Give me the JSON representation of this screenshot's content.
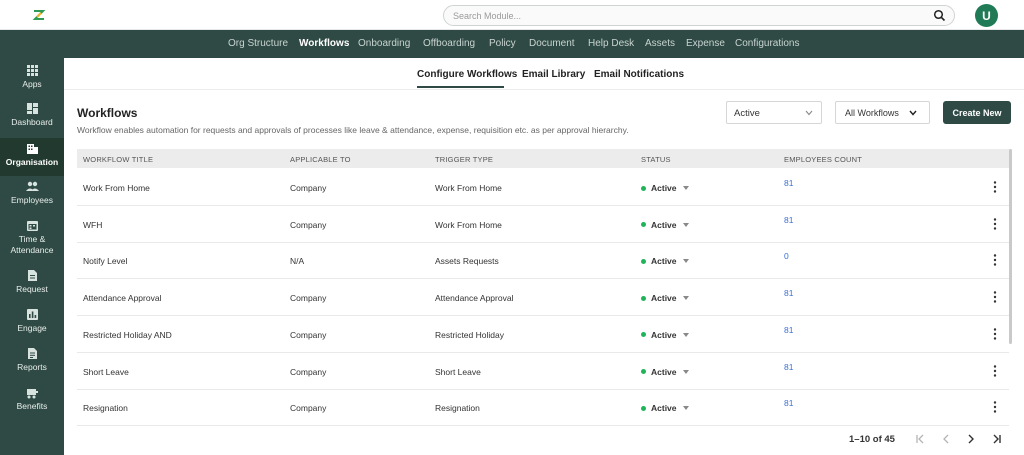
{
  "header": {
    "search_placeholder": "Search Module...",
    "avatar_initial": "U"
  },
  "topnav": {
    "items": [
      "Org Structure",
      "Workflows",
      "Onboarding",
      "Offboarding",
      "Policy",
      "Document",
      "Help Desk",
      "Assets",
      "Expense",
      "Configurations"
    ],
    "active": "Workflows"
  },
  "sidebar": {
    "items": [
      {
        "label": "Apps",
        "icon": "grid-icon"
      },
      {
        "label": "Dashboard",
        "icon": "dashboard-icon"
      },
      {
        "label": "Organisation",
        "icon": "building-icon"
      },
      {
        "label": "Employees",
        "icon": "people-icon"
      },
      {
        "label": "Time & Attendance",
        "icon": "calendar-icon"
      },
      {
        "label": "Request",
        "icon": "request-icon"
      },
      {
        "label": "Engage",
        "icon": "chart-icon"
      },
      {
        "label": "Reports",
        "icon": "report-icon"
      },
      {
        "label": "Benefits",
        "icon": "benefits-icon"
      }
    ],
    "active": "Organisation"
  },
  "subtabs": {
    "items": [
      "Configure Workflows",
      "Email Library",
      "Email Notifications"
    ],
    "active": "Configure Workflows"
  },
  "page": {
    "title": "Workflows",
    "description": "Workflow enables automation for requests and approvals of processes like leave & attendance, expense, requisition etc. as per approval hierarchy.",
    "status_filter": "Active",
    "workflow_filter": "All Workflows",
    "create_button": "Create New"
  },
  "table": {
    "headers": [
      "WORKFLOW TITLE",
      "APPLICABLE TO",
      "TRIGGER TYPE",
      "STATUS",
      "EMPLOYEES COUNT"
    ],
    "rows": [
      {
        "title": "Work From Home",
        "applicable": "Company",
        "trigger": "Work From Home",
        "status": "Active",
        "count": "81"
      },
      {
        "title": "WFH",
        "applicable": "Company",
        "trigger": "Work From Home",
        "status": "Active",
        "count": "81"
      },
      {
        "title": "Notify Level",
        "applicable": "N/A",
        "trigger": "Assets Requests",
        "status": "Active",
        "count": "0"
      },
      {
        "title": "Attendance Approval",
        "applicable": "Company",
        "trigger": "Attendance Approval",
        "status": "Active",
        "count": "81"
      },
      {
        "title": "Restricted Holiday AND",
        "applicable": "Company",
        "trigger": "Restricted Holiday",
        "status": "Active",
        "count": "81"
      },
      {
        "title": "Short Leave",
        "applicable": "Company",
        "trigger": "Short Leave",
        "status": "Active",
        "count": "81"
      },
      {
        "title": "Resignation",
        "applicable": "Company",
        "trigger": "Resignation",
        "status": "Active",
        "count": "81"
      }
    ]
  },
  "pagination": {
    "range_text": "1–10 of 45"
  },
  "colors": {
    "primary": "#2f4a44",
    "status_active": "#1fb45a",
    "link": "#3a6fd6"
  }
}
